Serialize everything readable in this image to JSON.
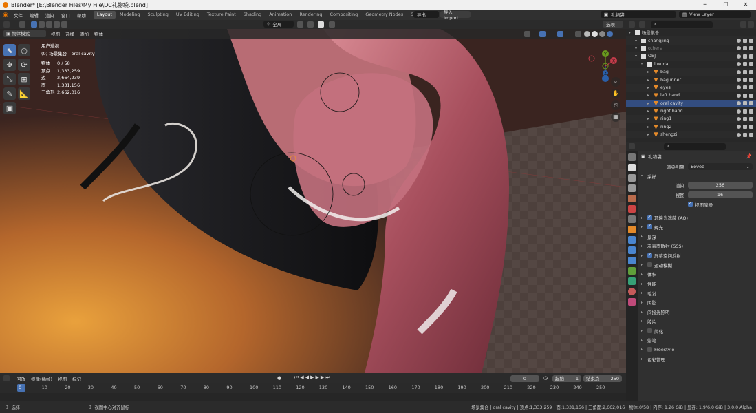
{
  "window": {
    "title": "Blender* [E:\\Blender Files\\My File\\DC礼物袋.blend]",
    "minimize": "─",
    "maximize": "☐",
    "close": "✕"
  },
  "menu": [
    "文件",
    "编辑",
    "渲染",
    "窗口",
    "帮助"
  ],
  "workspaces": [
    "Layout",
    "Modeling",
    "Sculpting",
    "UV Editing",
    "Texture Paint",
    "Shading",
    "Animation",
    "Rendering",
    "Compositing",
    "Geometry Nodes",
    "Scripting"
  ],
  "workspace_add": "+",
  "top_right": {
    "export_label": "导出",
    "import_label": "导入 Import",
    "scene_name": "礼物袋",
    "view_layer": "View Layer"
  },
  "viewport_header": {
    "mode": "物体模式",
    "menus": [
      "视图",
      "选择",
      "添加",
      "物体"
    ],
    "orientation": "全局",
    "options": "选项"
  },
  "viewport_overlay": {
    "view_name": "用户透视",
    "collection_line": "(0) 场景集合 | oral cavity",
    "stats": [
      {
        "key": "物体",
        "value": "0 / 58"
      },
      {
        "key": "顶点",
        "value": "1,333,259"
      },
      {
        "key": "边",
        "value": "2,664,239"
      },
      {
        "key": "面",
        "value": "1,331,156"
      },
      {
        "key": "三角形",
        "value": "2,662,016"
      }
    ]
  },
  "gizmo": {
    "x": "X",
    "y": "Y",
    "z": "Z"
  },
  "outliner": {
    "search_placeholder": "",
    "rows": [
      {
        "label": "场景集合",
        "depth": 0,
        "type": "scene"
      },
      {
        "label": "changjing",
        "depth": 1,
        "type": "collection"
      },
      {
        "label": "others",
        "depth": 1,
        "type": "collection"
      },
      {
        "label": "OBJ",
        "depth": 1,
        "type": "collection"
      },
      {
        "label": "liwudai",
        "depth": 2,
        "type": "collection"
      },
      {
        "label": "bag",
        "depth": 3,
        "type": "mesh"
      },
      {
        "label": "bag inner",
        "depth": 3,
        "type": "mesh"
      },
      {
        "label": "eyes",
        "depth": 3,
        "type": "mesh"
      },
      {
        "label": "left hand",
        "depth": 3,
        "type": "mesh"
      },
      {
        "label": "oral cavity",
        "depth": 3,
        "type": "mesh"
      },
      {
        "label": "right hand",
        "depth": 3,
        "type": "mesh"
      },
      {
        "label": "ring1",
        "depth": 3,
        "type": "mesh"
      },
      {
        "label": "ring2",
        "depth": 3,
        "type": "mesh"
      },
      {
        "label": "shengzi",
        "depth": 3,
        "type": "mesh"
      }
    ]
  },
  "properties": {
    "scene_name": "礼物袋",
    "render_engine_label": "渲染引擎",
    "render_engine_value": "Eevee",
    "sampling_title": "采样",
    "render_label": "渲染",
    "render_value": "256",
    "viewport_label": "视图",
    "viewport_value": "16",
    "viewport_denoise": "视图降噪",
    "panels": [
      {
        "label": "环境光遮蔽 (AO)",
        "checkbox": true
      },
      {
        "label": "辉光",
        "checkbox": true
      },
      {
        "label": "景深",
        "checkbox": null
      },
      {
        "label": "次表面散射 (SSS)",
        "checkbox": null
      },
      {
        "label": "屏幕空间反射",
        "checkbox": true
      },
      {
        "label": "运动模糊",
        "checkbox": false
      },
      {
        "label": "体积",
        "checkbox": null
      },
      {
        "label": "性能",
        "checkbox": null
      },
      {
        "label": "毛发",
        "checkbox": null
      },
      {
        "label": "阴影",
        "checkbox": null
      },
      {
        "label": "间接光照明",
        "checkbox": null
      },
      {
        "label": "胶片",
        "checkbox": null
      },
      {
        "label": "简化",
        "checkbox": false
      },
      {
        "label": "蜡笔",
        "checkbox": null
      },
      {
        "label": "Freestyle",
        "checkbox": false
      },
      {
        "label": "色彩管理",
        "checkbox": null
      }
    ]
  },
  "timeline": {
    "playback": "回放",
    "keying": "抠像(插帧)",
    "view": "视图",
    "marker": "标记",
    "current_frame": "0",
    "start_label": "起始",
    "start_value": "1",
    "end_label": "结束点",
    "end_value": "250",
    "ticks": [
      "0",
      "10",
      "20",
      "30",
      "40",
      "50",
      "60",
      "70",
      "80",
      "90",
      "100",
      "110",
      "120",
      "130",
      "140",
      "150",
      "160",
      "170",
      "180",
      "190",
      "200",
      "210",
      "220",
      "230",
      "240",
      "250"
    ]
  },
  "statusbar": {
    "select": "选择",
    "center": "视图中心对齐鼠标",
    "info": "场景集合 | oral cavity | 顶点:1,333,259 | 面:1,331,156 | 三角面:2,662,016 | 物体:0/58 | 内存: 1.26 GiB | 显存: 1.9/6.0 GiB | 3.0.0 Alpha"
  },
  "colors": {
    "accent": "#4772b3",
    "blender_orange": "#ea7600",
    "panel_bg": "#303030"
  }
}
